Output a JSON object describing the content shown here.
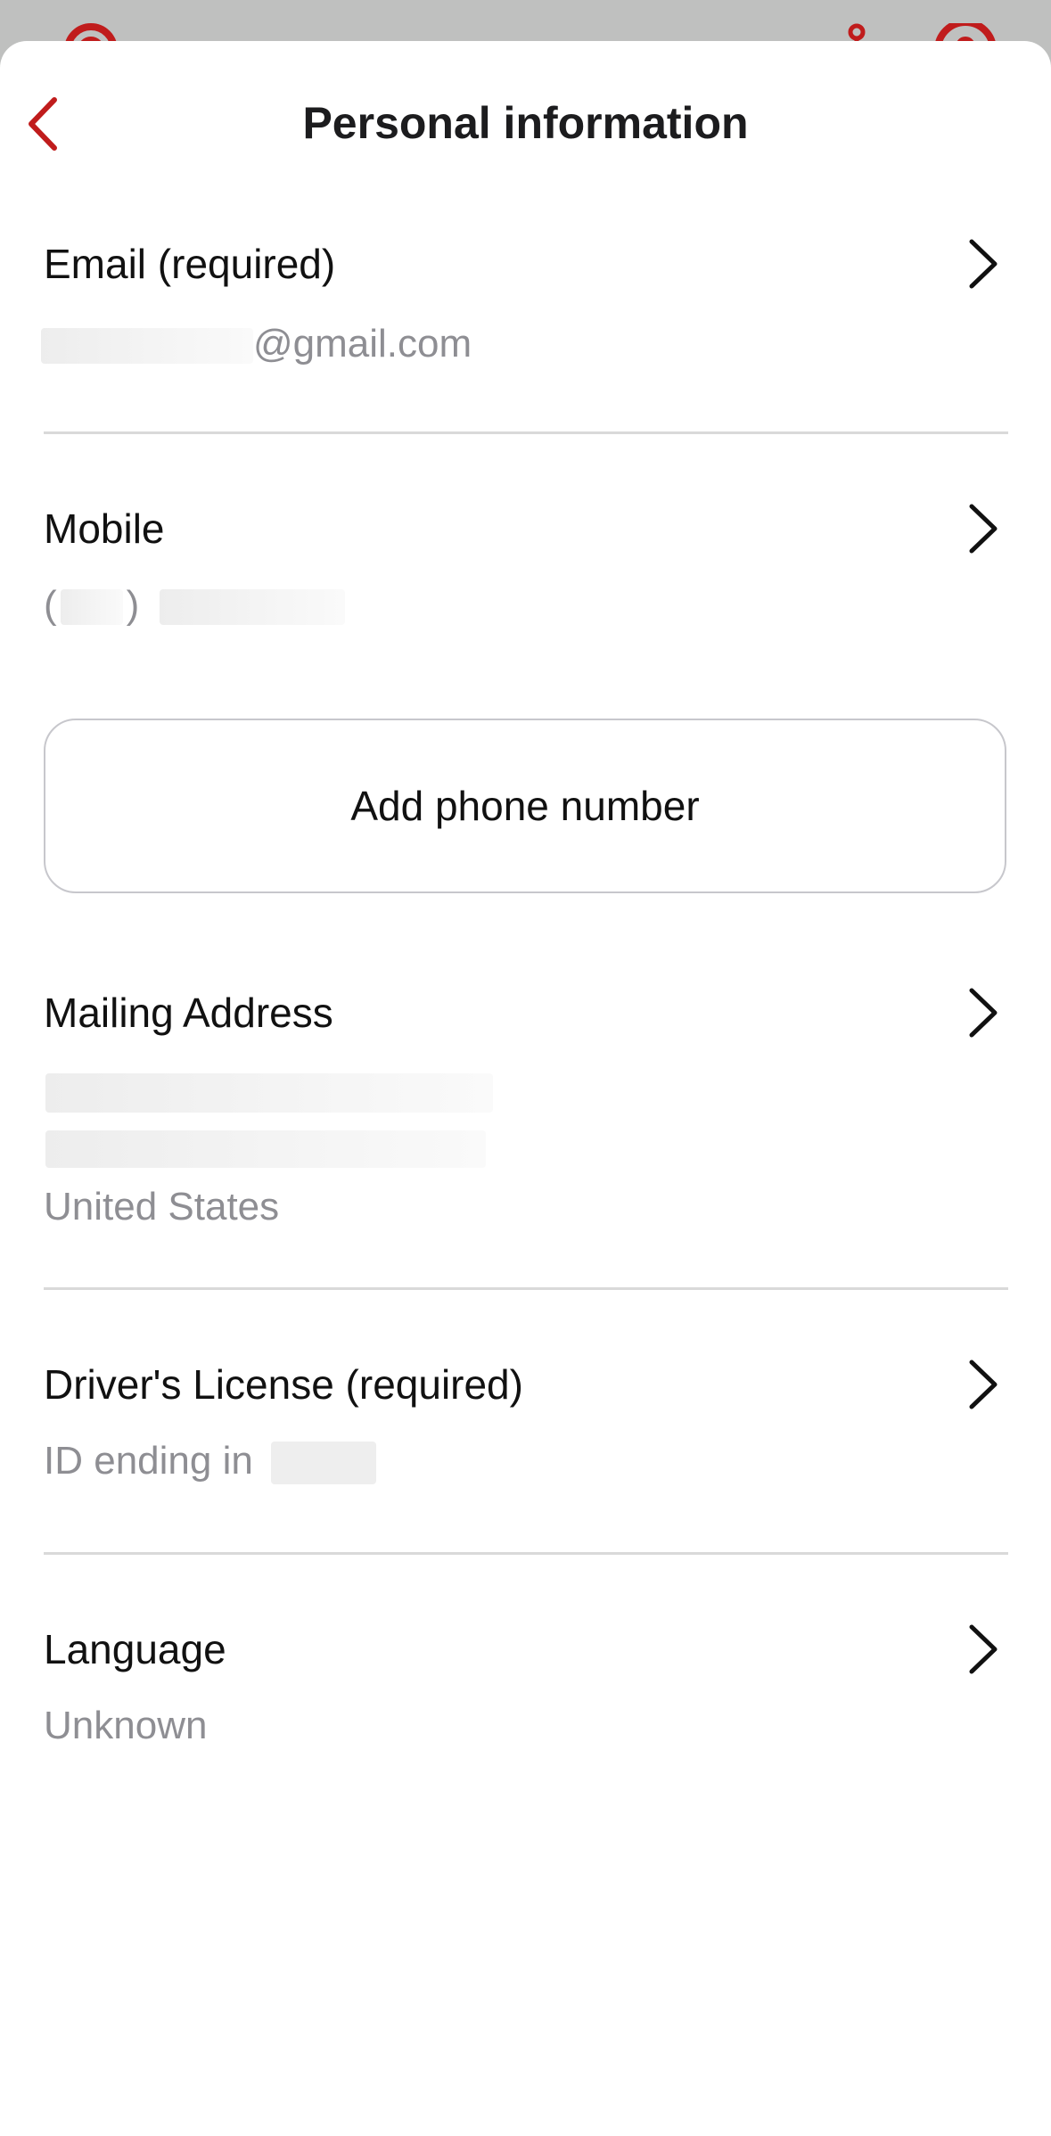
{
  "header": {
    "title": "Personal information"
  },
  "email": {
    "label": "Email (required)",
    "value_suffix": "@gmail.com"
  },
  "mobile": {
    "label": "Mobile",
    "paren_open": "(",
    "paren_close": ")"
  },
  "add_phone": {
    "label": "Add phone number"
  },
  "mailing": {
    "label": "Mailing Address",
    "country": "United States"
  },
  "license": {
    "label": "Driver's License (required)",
    "value_prefix": "ID ending in"
  },
  "language": {
    "label": "Language",
    "value": "Unknown"
  },
  "colors": {
    "accent": "#c01c1c",
    "label_text": "#111111",
    "secondary_text": "#8e8e93",
    "divider": "#d9d9d9"
  }
}
